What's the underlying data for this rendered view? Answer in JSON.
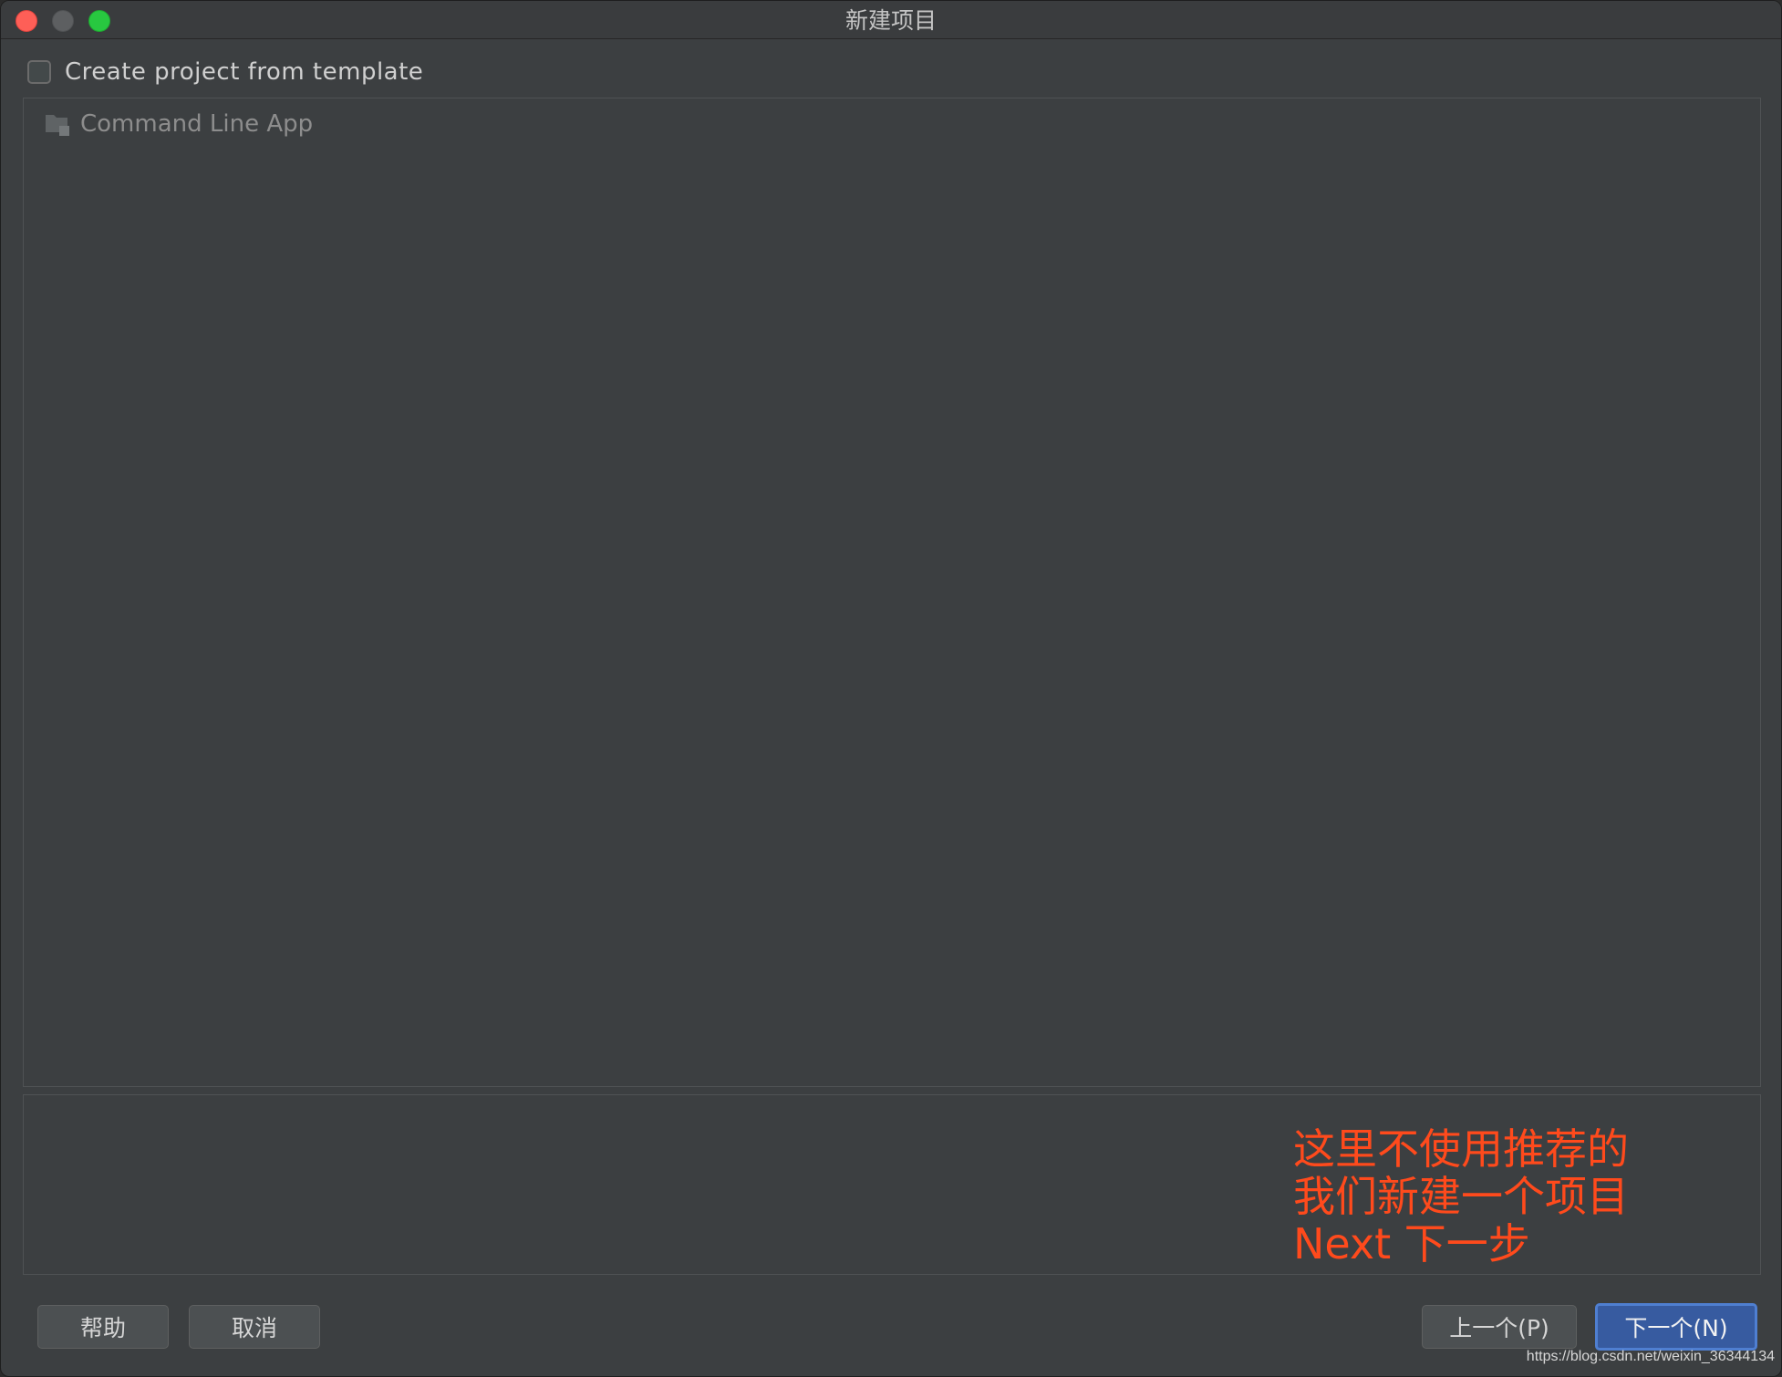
{
  "window": {
    "title": "新建项目"
  },
  "template": {
    "checkbox_label": "Create project from template",
    "checked": false
  },
  "templates_list": {
    "items": [
      {
        "label": "Command Line App",
        "icon": "folder-icon"
      }
    ]
  },
  "annotation": {
    "line1": "这里不使用推荐的",
    "line2": "我们新建一个项目",
    "line3": "Next 下一步",
    "color": "#ff4a1c"
  },
  "buttons": {
    "help": "帮助",
    "cancel": "取消",
    "previous": "上一个(P)",
    "next": "下一个(N)"
  },
  "watermark": "https://blog.csdn.net/weixin_36344134",
  "colors": {
    "background": "#3c3f41",
    "primary_button": "#375ba0",
    "annotation": "#ff4a1c"
  }
}
